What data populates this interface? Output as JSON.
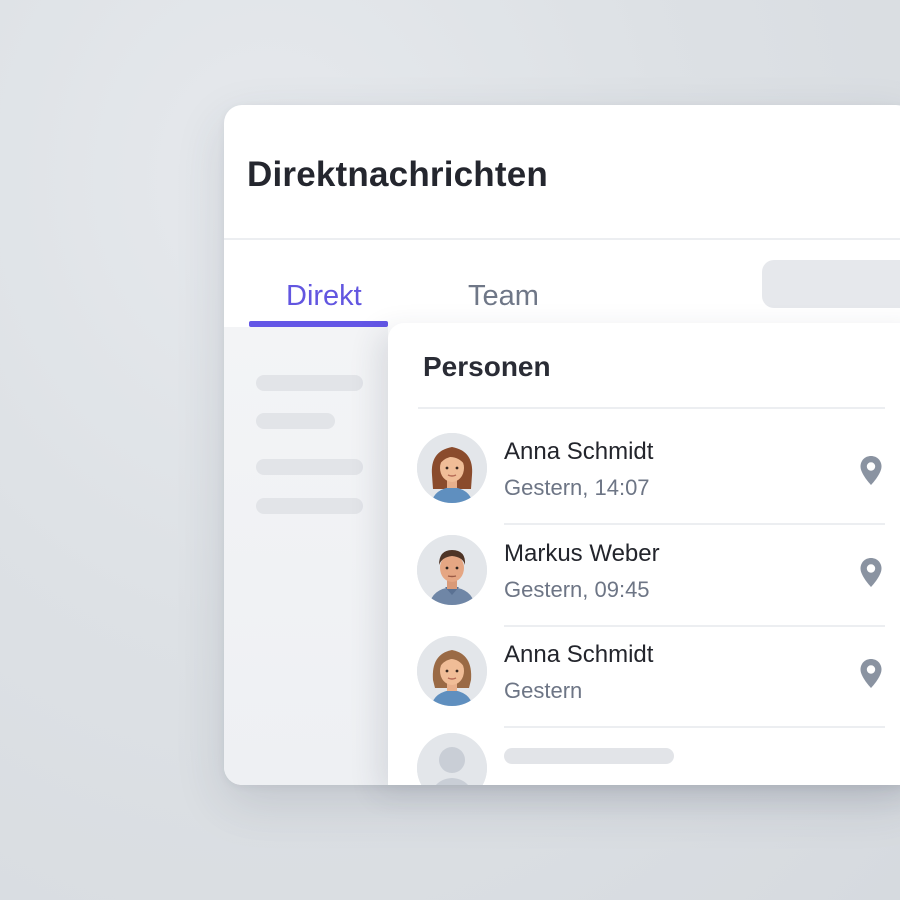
{
  "header": {
    "title": "Direktnachrichten"
  },
  "tabs": [
    {
      "label": "Direkt",
      "active": true
    },
    {
      "label": "Team",
      "active": false
    }
  ],
  "panel": {
    "title": "Personen",
    "people": [
      {
        "name": "Anna Schmidt",
        "time": "Gestern, 14:07",
        "icon": "location-pin-icon"
      },
      {
        "name": "Markus Weber",
        "time": "Gestern, 09:45",
        "icon": "location-pin-icon"
      },
      {
        "name": "Anna Schmidt",
        "time": "Gestern",
        "icon": "location-pin-icon"
      }
    ]
  },
  "colors": {
    "accent": "#6356e6",
    "text_primary": "#24262e",
    "text_secondary": "#6d7585",
    "icon": "#8a93a1"
  }
}
